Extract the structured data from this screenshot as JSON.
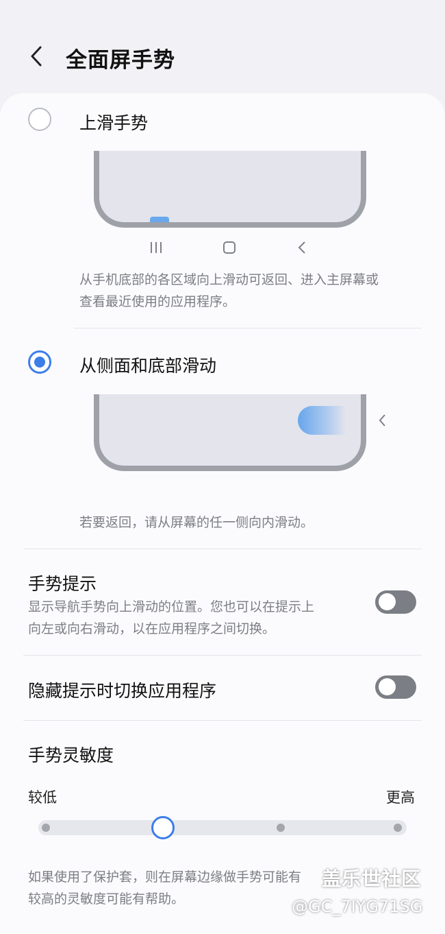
{
  "header": {
    "title": "全面屏手势"
  },
  "options": [
    {
      "label": "上滑手势",
      "selected": false,
      "nav_icons": [
        "recents-icon",
        "home-icon",
        "back-icon"
      ],
      "description": [
        "从手机底部的各区域向上滑动可返回、进入主屏幕或",
        "查看最近使用的应用程序。"
      ]
    },
    {
      "label": "从侧面和底部滑动",
      "selected": true,
      "description": [
        "若要返回，请从屏幕的任一侧向内滑动。"
      ]
    }
  ],
  "gesture_hint": {
    "title": "手势提示",
    "description": [
      "显示导航手势向上滑动的位置。您也可以在提示上",
      "向左或向右滑动，以在应用程序之间切换。"
    ],
    "enabled": false
  },
  "switch_apps": {
    "title": "隐藏提示时切换应用程序",
    "enabled": false
  },
  "sensitivity": {
    "title": "手势灵敏度",
    "low_label": "较低",
    "high_label": "更高",
    "level": 2,
    "levels": 4,
    "note": [
      "如果使用了保护套，则在屏幕边缘做手势可能有",
      "较高的灵敏度可能有帮助。"
    ]
  },
  "watermark": {
    "brand": "盖乐世社区",
    "user": "@GC_7IYG71SG"
  },
  "colors": {
    "accent": "#3c7de8",
    "toggle_off": "#7b7e85"
  }
}
